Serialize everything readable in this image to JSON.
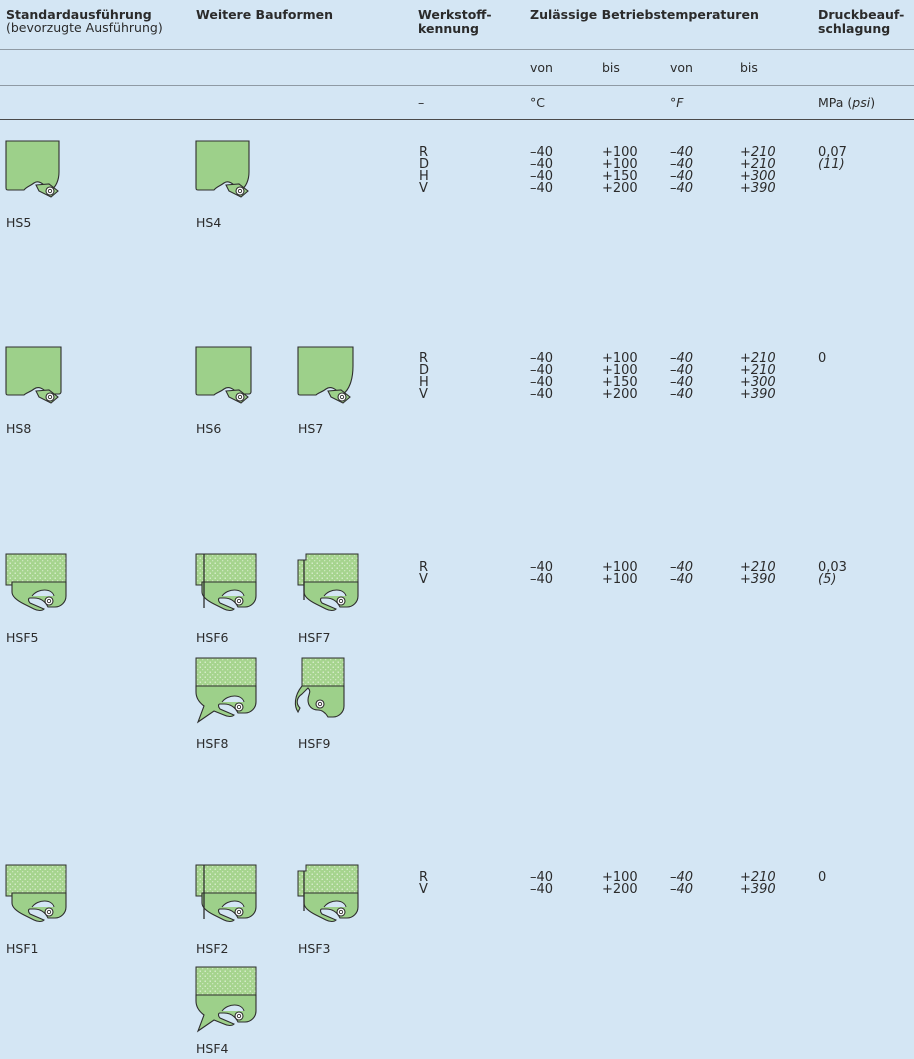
{
  "header": {
    "col_standard_title": "Standardausführung",
    "col_standard_sub": "(bevorzugte Ausführung)",
    "col_weitere": "Weitere Bauformen",
    "col_werkstoff_1": "Werkstoff-",
    "col_werkstoff_2": "kennung",
    "col_temp": "Zulässige Betriebstemperaturen",
    "col_druck_1": "Druckbeauf-",
    "col_druck_2": "schlagung",
    "von1": "von",
    "bis1": "bis",
    "von2": "von",
    "bis2": "bis",
    "unit_werkstoff": "–",
    "unit_c": "°C",
    "unit_f": "°F",
    "unit_mpa": "MPa (",
    "unit_psi": "psi",
    "unit_close": ")"
  },
  "rows": [
    {
      "standard": "HS5",
      "others": [
        "HS4"
      ],
      "materials": [
        "R",
        "D",
        "H",
        "V"
      ],
      "c_von": [
        "–40",
        "–40",
        "–40",
        "–40"
      ],
      "c_bis": [
        "+100",
        "+100",
        "+150",
        "+200"
      ],
      "f_von": [
        "–40",
        "–40",
        "–40",
        "–40"
      ],
      "f_bis": [
        "+210",
        "+210",
        "+300",
        "+390"
      ],
      "pressure": "0,07",
      "pressure_psi": "(11)"
    },
    {
      "standard": "HS8",
      "others": [
        "HS6",
        "HS7"
      ],
      "materials": [
        "R",
        "D",
        "H",
        "V"
      ],
      "c_von": [
        "–40",
        "–40",
        "–40",
        "–40"
      ],
      "c_bis": [
        "+100",
        "+100",
        "+150",
        "+200"
      ],
      "f_von": [
        "–40",
        "–40",
        "–40",
        "–40"
      ],
      "f_bis": [
        "+210",
        "+210",
        "+300",
        "+390"
      ],
      "pressure": "0",
      "pressure_psi": ""
    },
    {
      "standard": "HSF5",
      "others": [
        "HSF6",
        "HSF7",
        "HSF8",
        "HSF9"
      ],
      "materials": [
        "R",
        "V"
      ],
      "c_von": [
        "–40",
        "–40"
      ],
      "c_bis": [
        "+100",
        "+100"
      ],
      "f_von": [
        "–40",
        "–40"
      ],
      "f_bis": [
        "+210",
        "+390"
      ],
      "pressure": "0,03",
      "pressure_psi": "(5)"
    },
    {
      "standard": "HSF1",
      "others": [
        "HSF2",
        "HSF3",
        "HSF4"
      ],
      "materials": [
        "R",
        "V"
      ],
      "c_von": [
        "–40",
        "–40"
      ],
      "c_bis": [
        "+100",
        "+200"
      ],
      "f_von": [
        "–40",
        "–40"
      ],
      "f_bis": [
        "+210",
        "+390"
      ],
      "pressure": "0",
      "pressure_psi": ""
    }
  ]
}
